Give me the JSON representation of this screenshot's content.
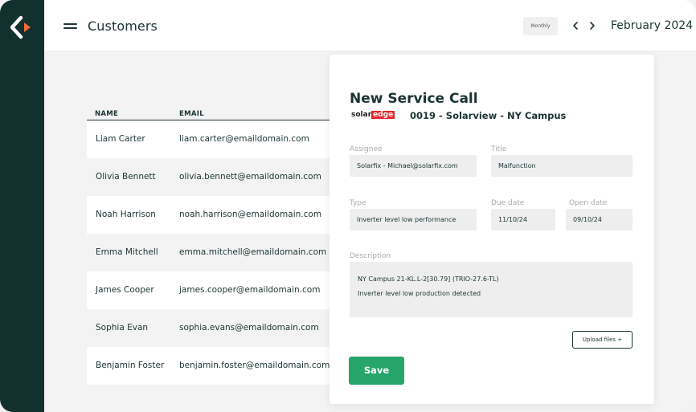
{
  "app": {
    "logo_icon": "back-arrow-logo-icon",
    "colors": {
      "rail": "#12302d",
      "accent": "#f26b3a",
      "primary_text": "#1b3433",
      "save": "#27a56a",
      "brand_red": "#e3262d"
    }
  },
  "header": {
    "title": "Customers",
    "menu_icon": "hamburger-menu-icon",
    "period_select": "Monthly",
    "prev_icon": "chevron-left-icon",
    "next_icon": "chevron-right-icon",
    "period_label": "February 2024"
  },
  "table": {
    "columns": [
      "NAME",
      "EMAIL"
    ],
    "rows": [
      {
        "name": "Liam Carter",
        "email": "liam.carter@emaildomain.com"
      },
      {
        "name": "Olivia Bennett",
        "email": "olivia.bennett@emaildomain.com"
      },
      {
        "name": "Noah Harrison",
        "email": "noah.harrison@emaildomain.com"
      },
      {
        "name": "Emma Mitchell",
        "email": "emma.mitchell@emaildomain.com"
      },
      {
        "name": "James Cooper",
        "email": "james.cooper@emaildomain.com"
      },
      {
        "name": "Sophia Evan",
        "email": "sophia.evans@emaildomain.com"
      },
      {
        "name": "Benjamin Foster",
        "email": "benjamin.foster@emaildomain.com"
      }
    ]
  },
  "service_call": {
    "title": "New Service Call",
    "brand_logo": {
      "part1": "solar",
      "part2": "edge"
    },
    "site": "0019 - Solarview - NY Campus",
    "fields": {
      "assignee": {
        "label": "Assignee",
        "value": "Solarfix -  Michael@solarfix.com"
      },
      "title": {
        "label": "Title",
        "value": "Malfunction"
      },
      "type": {
        "label": "Type",
        "value": "Inverter level low performance"
      },
      "due_date": {
        "label": "Due date",
        "value": "11/10/24"
      },
      "open_date": {
        "label": "Open date",
        "value": "09/10/24"
      },
      "description": {
        "label": "Description",
        "lines": [
          "NY Campus 21-KL.L-2[30.79] (TRIO-27.6-TL)",
          "Inverter level low production detected"
        ]
      }
    },
    "upload_label": "Upload files +",
    "save_label": "Save"
  }
}
